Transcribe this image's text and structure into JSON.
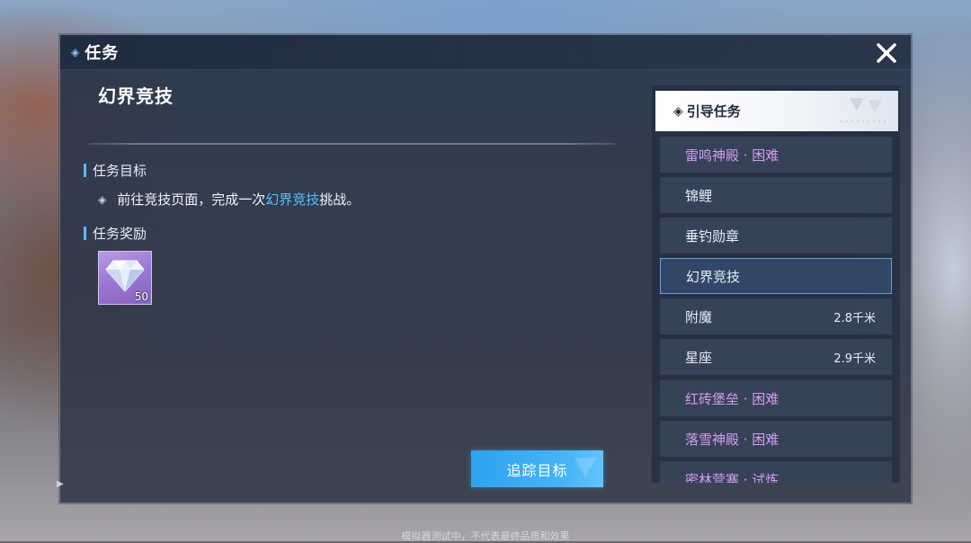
{
  "header": {
    "title": "任务"
  },
  "quest": {
    "title": "幻界竞技",
    "objective_heading": "任务目标",
    "objective_prefix": "前往竞技页面，完成一次",
    "objective_highlight": "幻界竞技",
    "objective_suffix": "挑战。",
    "reward_heading": "任务奖励",
    "reward": {
      "icon": "diamond-gem-icon",
      "count": "50"
    },
    "track_button": "追踪目标"
  },
  "list": {
    "category": "引导任务",
    "items": [
      {
        "name": "雷鸣神殿 · 困难",
        "distance": "",
        "style": "purple"
      },
      {
        "name": "锦鲤",
        "distance": "",
        "style": "normal"
      },
      {
        "name": "垂钓勋章",
        "distance": "",
        "style": "normal"
      },
      {
        "name": "幻界竞技",
        "distance": "",
        "style": "active"
      },
      {
        "name": "附魔",
        "distance": "2.8千米",
        "style": "normal"
      },
      {
        "name": "星座",
        "distance": "2.9千米",
        "style": "normal"
      },
      {
        "name": "红砖堡垒 · 困难",
        "distance": "",
        "style": "purple"
      },
      {
        "name": "落雪神殿 · 困难",
        "distance": "",
        "style": "purple"
      },
      {
        "name": "密林营寨 · 试炼",
        "distance": "",
        "style": "purple"
      }
    ]
  },
  "footer": "模拟器测试中，不代表最终品质和效果",
  "colors": {
    "accent": "#55c2ff",
    "purple": "#d49cf2",
    "button": "#3aa9f2"
  }
}
